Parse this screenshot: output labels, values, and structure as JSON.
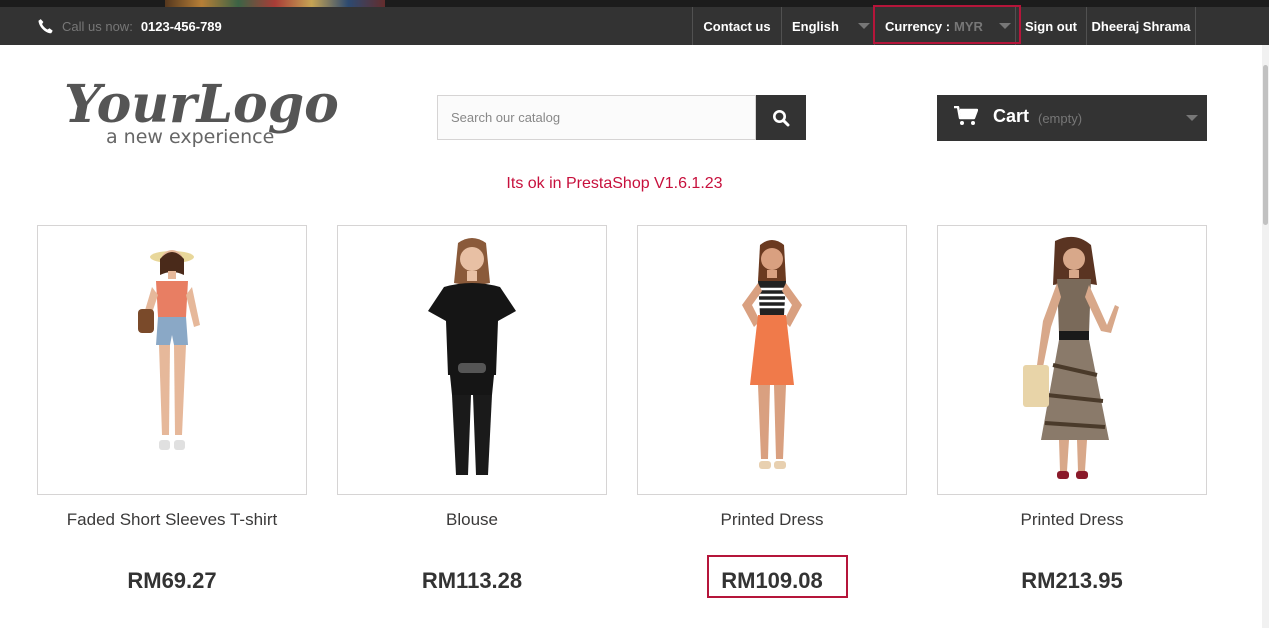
{
  "navbar": {
    "phone_prefix": "Call us now:",
    "phone_number": "0123-456-789",
    "contact": "Contact us",
    "language": "English",
    "currency_label": "Currency :",
    "currency_value": "MYR",
    "signout": "Sign out",
    "user": "Dheeraj Shrama"
  },
  "logo": {
    "main": "YourLogo",
    "tagline": "a new experience"
  },
  "search": {
    "placeholder": "Search our catalog"
  },
  "cart": {
    "label": "Cart",
    "status": "(empty)"
  },
  "notice": "Its ok in PrestaShop V1.6.1.23",
  "products": [
    {
      "name": "Faded Short Sleeves T-shirt",
      "price": "RM69.27"
    },
    {
      "name": "Blouse",
      "price": "RM113.28"
    },
    {
      "name": "Printed Dress",
      "price": "RM109.08"
    },
    {
      "name": "Printed Dress",
      "price": "RM213.95"
    }
  ],
  "colors": {
    "navbar": "#333333",
    "highlight": "#b5153a",
    "notice": "#c7103c"
  },
  "icons": [
    "phone-icon",
    "search-icon",
    "cart-icon",
    "chevron-down-icon"
  ]
}
